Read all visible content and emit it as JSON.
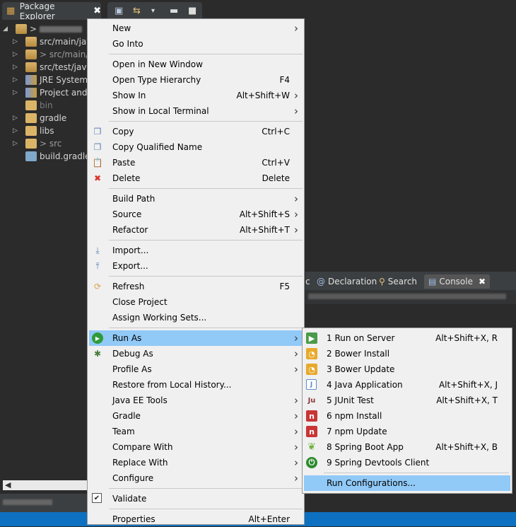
{
  "package_explorer": {
    "tab_title": "Package Explorer",
    "project_arrow": ">",
    "tree": [
      {
        "label": "src/main/jav",
        "icon": "package-folder-icon",
        "style": "normal",
        "arrow": "▷"
      },
      {
        "label": "> src/main/",
        "icon": "package-folder-icon",
        "style": "link",
        "arrow": "▷"
      },
      {
        "label": "src/test/java",
        "icon": "package-folder-icon",
        "style": "normal",
        "arrow": "▷"
      },
      {
        "label": "JRE System",
        "icon": "library-icon",
        "style": "normal",
        "arrow": "▷"
      },
      {
        "label": "Project and",
        "icon": "library-icon",
        "style": "normal",
        "arrow": "▷"
      },
      {
        "label": "bin",
        "icon": "folder-icon",
        "style": "dim",
        "arrow": ""
      },
      {
        "label": "gradle",
        "icon": "folder-icon",
        "style": "normal",
        "arrow": "▷"
      },
      {
        "label": "libs",
        "icon": "folder-icon",
        "style": "normal",
        "arrow": "▷"
      },
      {
        "label": "> src",
        "icon": "folder-icon",
        "style": "link",
        "arrow": "▷"
      },
      {
        "label": "build.gradle",
        "icon": "gradle-file-icon",
        "style": "normal",
        "arrow": ""
      }
    ]
  },
  "console_tabs": {
    "c_label": "c",
    "declaration": "Declaration",
    "search": "Search",
    "console": "Console"
  },
  "context_menu": {
    "items": [
      {
        "label": "New",
        "accel": "",
        "submenu": true,
        "icon": ""
      },
      {
        "label": "Go Into",
        "accel": "",
        "submenu": false,
        "icon": ""
      },
      {
        "label": "Open in New Window",
        "accel": "",
        "submenu": false,
        "icon": ""
      },
      {
        "label": "Open Type Hierarchy",
        "accel": "F4",
        "submenu": false,
        "icon": ""
      },
      {
        "label": "Show In",
        "accel": "Alt+Shift+W",
        "submenu": true,
        "icon": ""
      },
      {
        "label": "Show in Local Terminal",
        "accel": "",
        "submenu": true,
        "icon": ""
      },
      {
        "label": "Copy",
        "accel": "Ctrl+C",
        "submenu": false,
        "icon": "copy-icon"
      },
      {
        "label": "Copy Qualified Name",
        "accel": "",
        "submenu": false,
        "icon": "copy-qualified-icon"
      },
      {
        "label": "Paste",
        "accel": "Ctrl+V",
        "submenu": false,
        "icon": "paste-icon"
      },
      {
        "label": "Delete",
        "accel": "Delete",
        "submenu": false,
        "icon": "delete-icon"
      },
      {
        "label": "Build Path",
        "accel": "",
        "submenu": true,
        "icon": ""
      },
      {
        "label": "Source",
        "accel": "Alt+Shift+S",
        "submenu": true,
        "icon": ""
      },
      {
        "label": "Refactor",
        "accel": "Alt+Shift+T",
        "submenu": true,
        "icon": ""
      },
      {
        "label": "Import...",
        "accel": "",
        "submenu": false,
        "icon": "import-icon"
      },
      {
        "label": "Export...",
        "accel": "",
        "submenu": false,
        "icon": "export-icon"
      },
      {
        "label": "Refresh",
        "accel": "F5",
        "submenu": false,
        "icon": "refresh-icon"
      },
      {
        "label": "Close Project",
        "accel": "",
        "submenu": false,
        "icon": ""
      },
      {
        "label": "Assign Working Sets...",
        "accel": "",
        "submenu": false,
        "icon": ""
      },
      {
        "label": "Run As",
        "accel": "",
        "submenu": true,
        "icon": "run-icon",
        "highlighted": true
      },
      {
        "label": "Debug As",
        "accel": "",
        "submenu": true,
        "icon": "debug-icon"
      },
      {
        "label": "Profile As",
        "accel": "",
        "submenu": true,
        "icon": ""
      },
      {
        "label": "Restore from Local History...",
        "accel": "",
        "submenu": false,
        "icon": ""
      },
      {
        "label": "Java EE Tools",
        "accel": "",
        "submenu": true,
        "icon": ""
      },
      {
        "label": "Gradle",
        "accel": "",
        "submenu": true,
        "icon": ""
      },
      {
        "label": "Team",
        "accel": "",
        "submenu": true,
        "icon": ""
      },
      {
        "label": "Compare With",
        "accel": "",
        "submenu": true,
        "icon": ""
      },
      {
        "label": "Replace With",
        "accel": "",
        "submenu": true,
        "icon": ""
      },
      {
        "label": "Configure",
        "accel": "",
        "submenu": true,
        "icon": ""
      },
      {
        "label": "Validate",
        "accel": "",
        "submenu": false,
        "icon": "checkbox-checked-icon"
      },
      {
        "label": "Properties",
        "accel": "Alt+Enter",
        "submenu": false,
        "icon": ""
      }
    ]
  },
  "run_as_submenu": {
    "items": [
      {
        "label": "1 Run on Server",
        "accel": "Alt+Shift+X, R",
        "icon": "server-run-icon",
        "color": "#4a9a4a"
      },
      {
        "label": "2 Bower Install",
        "accel": "",
        "icon": "bower-icon",
        "color": "#e8a92a"
      },
      {
        "label": "3 Bower Update",
        "accel": "",
        "icon": "bower-icon",
        "color": "#e8a92a"
      },
      {
        "label": "4 Java Application",
        "accel": "Alt+Shift+X, J",
        "icon": "java-app-icon",
        "color": "#5b8cc9"
      },
      {
        "label": "5 JUnit Test",
        "accel": "Alt+Shift+X, T",
        "icon": "junit-icon",
        "color": "#8a3a3a"
      },
      {
        "label": "6 npm Install",
        "accel": "",
        "icon": "npm-icon",
        "color": "#c93535"
      },
      {
        "label": "7 npm Update",
        "accel": "",
        "icon": "npm-icon",
        "color": "#c93535"
      },
      {
        "label": "8 Spring Boot App",
        "accel": "Alt+Shift+X, B",
        "icon": "spring-boot-icon",
        "color": "#6db33f"
      },
      {
        "label": "9 Spring Devtools Client",
        "accel": "",
        "icon": "spring-devtools-icon",
        "color": "#2e8b2e"
      },
      {
        "label": "Run Configurations...",
        "accel": "",
        "icon": "",
        "highlighted": true
      }
    ]
  }
}
